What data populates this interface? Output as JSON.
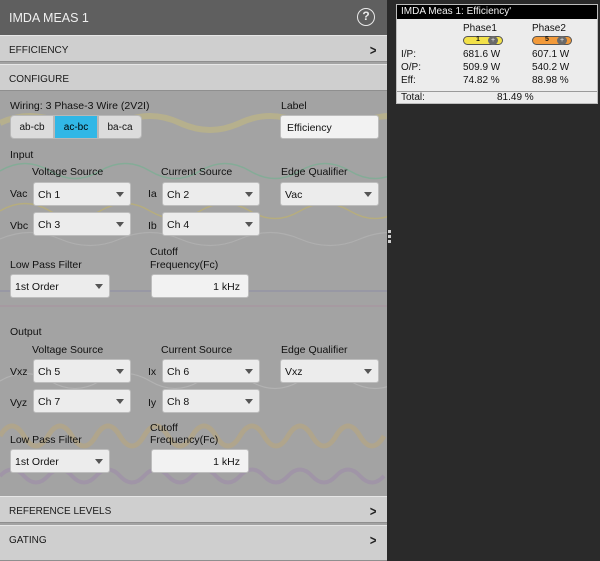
{
  "panel": {
    "title": "IMDA MEAS 1",
    "sections": {
      "efficiency": "EFFICIENCY",
      "configure": "CONFIGURE",
      "reference_levels": "REFERENCE LEVELS",
      "gating": "GATING"
    }
  },
  "wiring": {
    "label": "Wiring: 3 Phase-3 Wire (2V2I)",
    "options": [
      "ab-cb",
      "ac-bc",
      "ba-ca"
    ],
    "selected": "ac-bc"
  },
  "label_field": {
    "caption": "Label",
    "value": "Efficiency"
  },
  "input": {
    "heading": "Input",
    "voltage_source_caption": "Voltage Source",
    "current_source_caption": "Current Source",
    "edge_qualifier_caption": "Edge Qualifier",
    "rows": [
      {
        "v_label": "Vac",
        "v_value": "Ch 1",
        "i_label": "Ia",
        "i_value": "Ch 2"
      },
      {
        "v_label": "Vbc",
        "v_value": "Ch 3",
        "i_label": "Ib",
        "i_value": "Ch 4"
      }
    ],
    "edge_qualifier_value": "Vac",
    "lpf_caption": "Low Pass Filter",
    "lpf_value": "1st Order",
    "cutoff_caption_1": "Cutoff",
    "cutoff_caption_2": "Frequency(Fc)",
    "cutoff_value": "1 kHz"
  },
  "output": {
    "heading": "Output",
    "voltage_source_caption": "Voltage Source",
    "current_source_caption": "Current Source",
    "edge_qualifier_caption": "Edge Qualifier",
    "rows": [
      {
        "v_label": "Vxz",
        "v_value": "Ch 5",
        "i_label": "Ix",
        "i_value": "Ch 6"
      },
      {
        "v_label": "Vyz",
        "v_value": "Ch 7",
        "i_label": "Iy",
        "i_value": "Ch 8"
      }
    ],
    "edge_qualifier_value": "Vxz",
    "lpf_caption": "Low Pass Filter",
    "lpf_value": "1st Order",
    "cutoff_caption_1": "Cutoff",
    "cutoff_caption_2": "Frequency(Fc)",
    "cutoff_value": "1 kHz"
  },
  "results": {
    "title": "IMDA Meas 1: Efficiency'",
    "phase_headers": [
      "Phase1",
      "Phase2"
    ],
    "phase_badges": [
      {
        "num": "1",
        "color": "#f2e14a"
      },
      {
        "num": "5",
        "color": "#f29a3a"
      }
    ],
    "rows": [
      {
        "label": "I/P:",
        "phase1": "681.6 W",
        "phase2": "607.1 W"
      },
      {
        "label": "O/P:",
        "phase1": "509.9 W",
        "phase2": "540.2 W"
      },
      {
        "label": "Eff:",
        "phase1": "74.82 %",
        "phase2": "88.98 %"
      }
    ],
    "total_label": "Total:",
    "total_value": "81.49 %"
  }
}
